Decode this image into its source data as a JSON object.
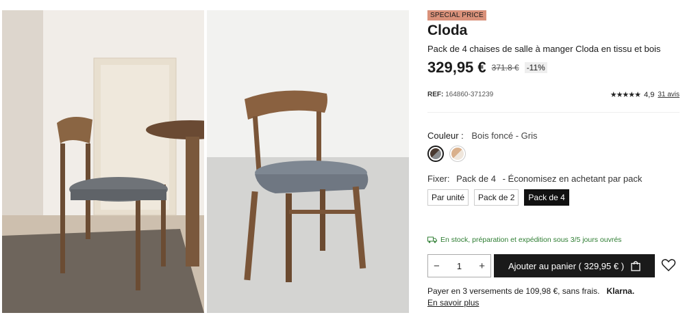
{
  "product": {
    "badge": "SPECIAL PRICE",
    "title": "Cloda",
    "subtitle": "Pack de 4 chaises de salle à manger Cloda en tissu et bois",
    "price": "329,95 €",
    "old_price": "371.8 €",
    "discount": "-11%",
    "ref_label": "REF:",
    "ref_value": "164860-371239",
    "stars": "★★★★★",
    "rating": "4,9",
    "reviews": "31 avis"
  },
  "color": {
    "label": "Couleur :",
    "value": "Bois foncé - Gris",
    "swatches": [
      {
        "name": "Bois foncé - Gris",
        "color_a": "#4a3a30",
        "color_b": "#8a8c8e",
        "selected": true
      },
      {
        "name": "Bois clair - Beige",
        "color_a": "#d9b08c",
        "color_b": "#efe6dc",
        "selected": false
      }
    ]
  },
  "fixer": {
    "label": "Fixer:",
    "value": "Pack de 4",
    "hint": "- Économisez en achetant par pack",
    "options": [
      "Par unité",
      "Pack de 2",
      "Pack de 4"
    ],
    "selected_index": 2
  },
  "stock": {
    "text": "En stock, préparation et expédition sous 3/5 jours ouvrés",
    "color": "#2e7d32"
  },
  "cart": {
    "quantity": "1",
    "minus": "−",
    "plus": "+",
    "button_label": "Ajouter au panier ( 329,95 € )"
  },
  "payment": {
    "text": "Payer en 3 versements de 109,98 €, sans frais.",
    "provider": "Klarna.",
    "learn_more": "En savoir plus"
  }
}
